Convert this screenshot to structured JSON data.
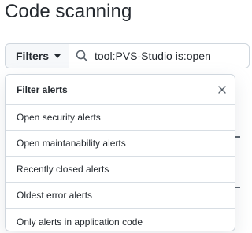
{
  "page": {
    "title": "Code scanning"
  },
  "toolbar": {
    "filters_label": "Filters",
    "search_value": "tool:PVS-Studio is:open",
    "icons": {
      "caret": "chevron-down-icon",
      "search": "search-icon"
    }
  },
  "dropdown": {
    "title": "Filter alerts",
    "close_icon": "close-icon",
    "items": [
      {
        "label": "Open security alerts"
      },
      {
        "label": "Open maintanability alerts"
      },
      {
        "label": "Recently closed alerts"
      },
      {
        "label": "Oldest error alerts"
      },
      {
        "label": "Only alerts in application code"
      }
    ]
  },
  "colors": {
    "text": "#24292f",
    "muted_icon": "#57606a",
    "border": "#d0d7de",
    "button_bg": "#f6f8fa"
  }
}
